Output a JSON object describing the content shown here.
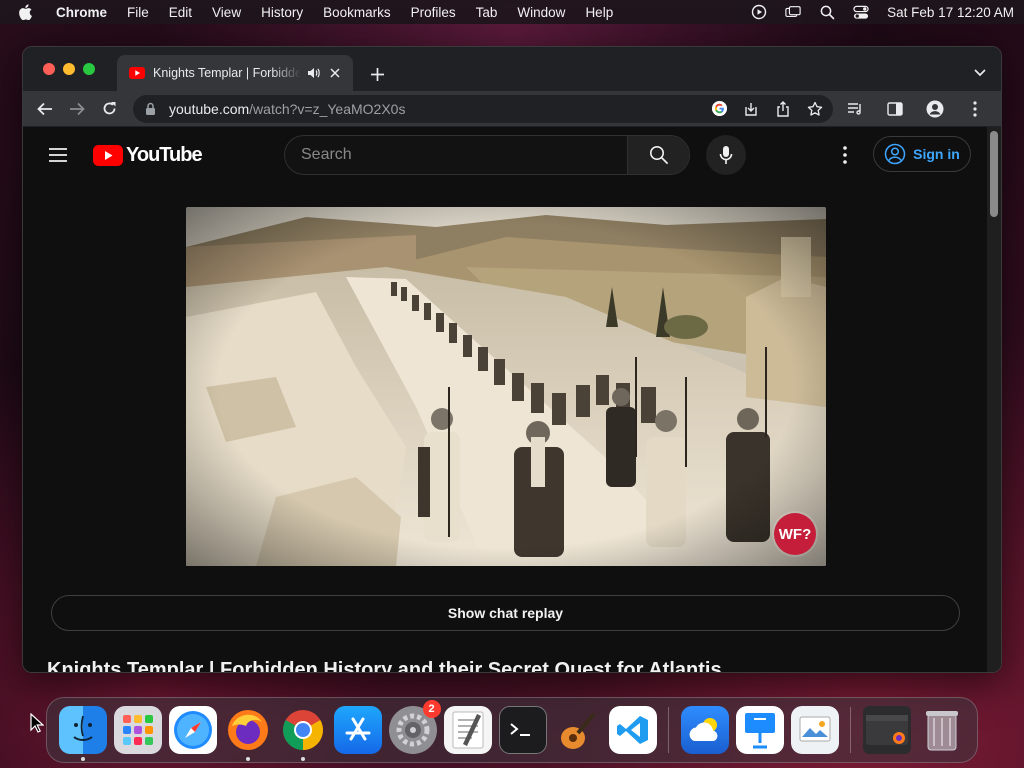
{
  "menubar": {
    "app_name": "Chrome",
    "items": [
      "File",
      "Edit",
      "View",
      "History",
      "Bookmarks",
      "Profiles",
      "Tab",
      "Window",
      "Help"
    ],
    "clock": "Sat Feb 17  12:20 AM",
    "status_icons": [
      "play-circle-icon",
      "screen-mirroring-icon",
      "spotlight-search-icon",
      "control-center-icon"
    ]
  },
  "browser": {
    "tab": {
      "title": "Knights Templar | Forbidden History and their Secret Quest for Atlantis",
      "favicon": "youtube-favicon-icon",
      "audio": "speaker-icon"
    },
    "address": {
      "host": "youtube.com",
      "path": "/watch?v=z_YeaMO2X0s"
    }
  },
  "youtube": {
    "logo_text": "YouTube",
    "search_placeholder": "Search",
    "sign_in_label": "Sign in",
    "chat_replay_label": "Show chat replay",
    "video_title": "Knights Templar | Forbidden History and their Secret Quest for Atlantis",
    "player_badge": "WF?"
  },
  "dock": {
    "apps": [
      {
        "name": "Finder",
        "running": true
      },
      {
        "name": "Launchpad",
        "running": false
      },
      {
        "name": "Safari",
        "running": false
      },
      {
        "name": "Firefox",
        "running": true
      },
      {
        "name": "Chrome",
        "running": true
      },
      {
        "name": "App Store",
        "running": false
      },
      {
        "name": "System Settings",
        "running": false,
        "badge": "2"
      },
      {
        "name": "TextEdit",
        "running": false
      },
      {
        "name": "Terminal",
        "running": false
      },
      {
        "name": "GarageBand",
        "running": false
      },
      {
        "name": "Visual Studio Code",
        "running": false
      },
      {
        "name": "Weather",
        "running": false
      },
      {
        "name": "Keynote",
        "running": false
      },
      {
        "name": "Preview",
        "running": false
      },
      {
        "name": "Recent Window",
        "running": false
      },
      {
        "name": "Trash",
        "running": false
      }
    ]
  },
  "colors": {
    "yt_red": "#ff0000",
    "link_blue": "#3ea6ff",
    "badge_red": "#c41e3a"
  }
}
